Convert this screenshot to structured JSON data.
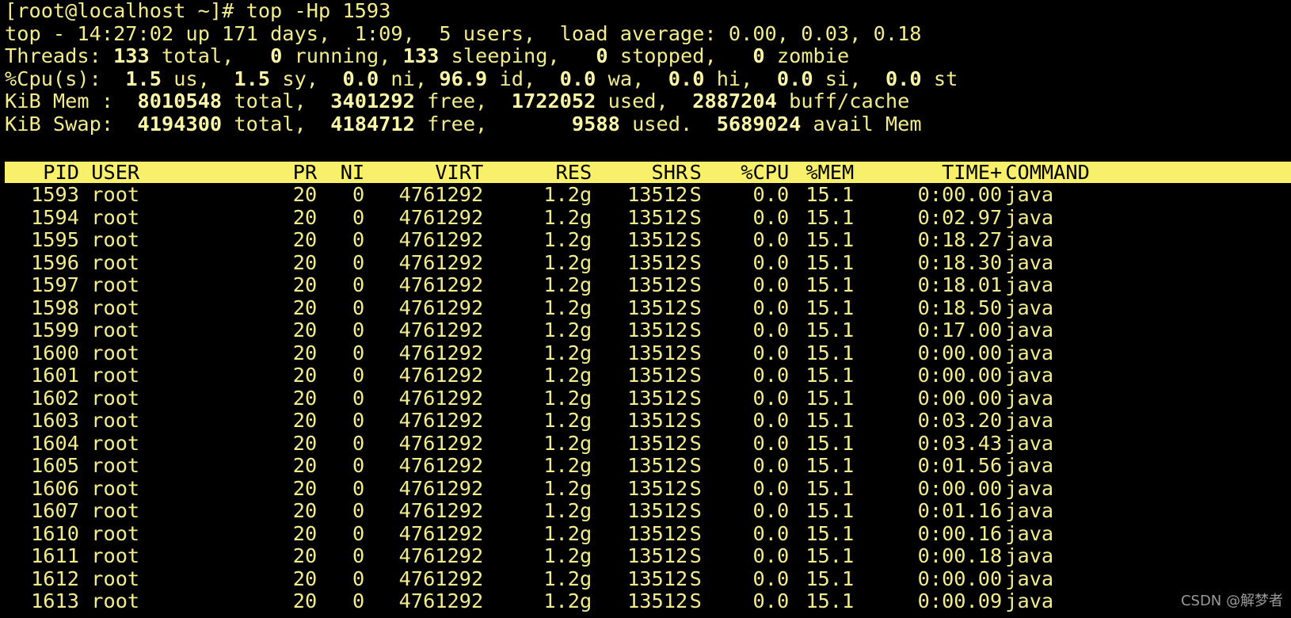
{
  "terminal": {
    "prompt": "[root@localhost ~]# top -Hp 1593",
    "top_line": {
      "prefix": "top - ",
      "time": "14:27:02",
      "uptime": "up 171 days,  1:09,",
      "users": "5 users,",
      "load_label": "load average:",
      "load_values": "0.00, 0.03, 0.18"
    },
    "threads": {
      "label": "Threads:",
      "total": "133",
      "total_label": "total,",
      "running": "0",
      "running_label": "running,",
      "sleeping": "133",
      "sleeping_label": "sleeping,",
      "stopped": "0",
      "stopped_label": "stopped,",
      "zombie": "0",
      "zombie_label": "zombie"
    },
    "cpu": {
      "label": "%Cpu(s):",
      "us": "1.5",
      "sy": "1.5",
      "ni": "0.0",
      "id": "96.9",
      "wa": "0.0",
      "hi": "0.0",
      "si": "0.0",
      "st": "0.0"
    },
    "mem": {
      "label": "KiB Mem :",
      "total": "8010548",
      "free": "3401292",
      "used": "1722052",
      "buff_cache": "2887204",
      "total_label": "total,",
      "free_label": "free,",
      "used_label": "used,",
      "buff_label": "buff/cache"
    },
    "swap": {
      "label": "KiB Swap:",
      "total": "4194300",
      "free": "4184712",
      "used": "9588",
      "avail": "5689024",
      "total_label": "total,",
      "free_label": "free,",
      "used_label": "used.",
      "avail_label": "avail Mem"
    }
  },
  "table": {
    "headers": [
      "PID",
      "USER",
      "PR",
      "NI",
      "VIRT",
      "RES",
      "SHR",
      "S",
      "%CPU",
      "%MEM",
      "TIME+",
      "COMMAND"
    ],
    "rows": [
      [
        "1593",
        "root",
        "20",
        "0",
        "4761292",
        "1.2g",
        "13512",
        "S",
        "0.0",
        "15.1",
        "0:00.00",
        "java"
      ],
      [
        "1594",
        "root",
        "20",
        "0",
        "4761292",
        "1.2g",
        "13512",
        "S",
        "0.0",
        "15.1",
        "0:02.97",
        "java"
      ],
      [
        "1595",
        "root",
        "20",
        "0",
        "4761292",
        "1.2g",
        "13512",
        "S",
        "0.0",
        "15.1",
        "0:18.27",
        "java"
      ],
      [
        "1596",
        "root",
        "20",
        "0",
        "4761292",
        "1.2g",
        "13512",
        "S",
        "0.0",
        "15.1",
        "0:18.30",
        "java"
      ],
      [
        "1597",
        "root",
        "20",
        "0",
        "4761292",
        "1.2g",
        "13512",
        "S",
        "0.0",
        "15.1",
        "0:18.01",
        "java"
      ],
      [
        "1598",
        "root",
        "20",
        "0",
        "4761292",
        "1.2g",
        "13512",
        "S",
        "0.0",
        "15.1",
        "0:18.50",
        "java"
      ],
      [
        "1599",
        "root",
        "20",
        "0",
        "4761292",
        "1.2g",
        "13512",
        "S",
        "0.0",
        "15.1",
        "0:17.00",
        "java"
      ],
      [
        "1600",
        "root",
        "20",
        "0",
        "4761292",
        "1.2g",
        "13512",
        "S",
        "0.0",
        "15.1",
        "0:00.00",
        "java"
      ],
      [
        "1601",
        "root",
        "20",
        "0",
        "4761292",
        "1.2g",
        "13512",
        "S",
        "0.0",
        "15.1",
        "0:00.00",
        "java"
      ],
      [
        "1602",
        "root",
        "20",
        "0",
        "4761292",
        "1.2g",
        "13512",
        "S",
        "0.0",
        "15.1",
        "0:00.00",
        "java"
      ],
      [
        "1603",
        "root",
        "20",
        "0",
        "4761292",
        "1.2g",
        "13512",
        "S",
        "0.0",
        "15.1",
        "0:03.20",
        "java"
      ],
      [
        "1604",
        "root",
        "20",
        "0",
        "4761292",
        "1.2g",
        "13512",
        "S",
        "0.0",
        "15.1",
        "0:03.43",
        "java"
      ],
      [
        "1605",
        "root",
        "20",
        "0",
        "4761292",
        "1.2g",
        "13512",
        "S",
        "0.0",
        "15.1",
        "0:01.56",
        "java"
      ],
      [
        "1606",
        "root",
        "20",
        "0",
        "4761292",
        "1.2g",
        "13512",
        "S",
        "0.0",
        "15.1",
        "0:00.00",
        "java"
      ],
      [
        "1607",
        "root",
        "20",
        "0",
        "4761292",
        "1.2g",
        "13512",
        "S",
        "0.0",
        "15.1",
        "0:01.16",
        "java"
      ],
      [
        "1610",
        "root",
        "20",
        "0",
        "4761292",
        "1.2g",
        "13512",
        "S",
        "0.0",
        "15.1",
        "0:00.16",
        "java"
      ],
      [
        "1611",
        "root",
        "20",
        "0",
        "4761292",
        "1.2g",
        "13512",
        "S",
        "0.0",
        "15.1",
        "0:00.18",
        "java"
      ],
      [
        "1612",
        "root",
        "20",
        "0",
        "4761292",
        "1.2g",
        "13512",
        "S",
        "0.0",
        "15.1",
        "0:00.00",
        "java"
      ],
      [
        "1613",
        "root",
        "20",
        "0",
        "4761292",
        "1.2g",
        "13512",
        "S",
        "0.0",
        "15.1",
        "0:00.09",
        "java"
      ]
    ]
  },
  "watermark": "CSDN @解梦者",
  "colors": {
    "background": "#000000",
    "text": "#f2ec8c",
    "header_bar": "#f8f06a"
  }
}
